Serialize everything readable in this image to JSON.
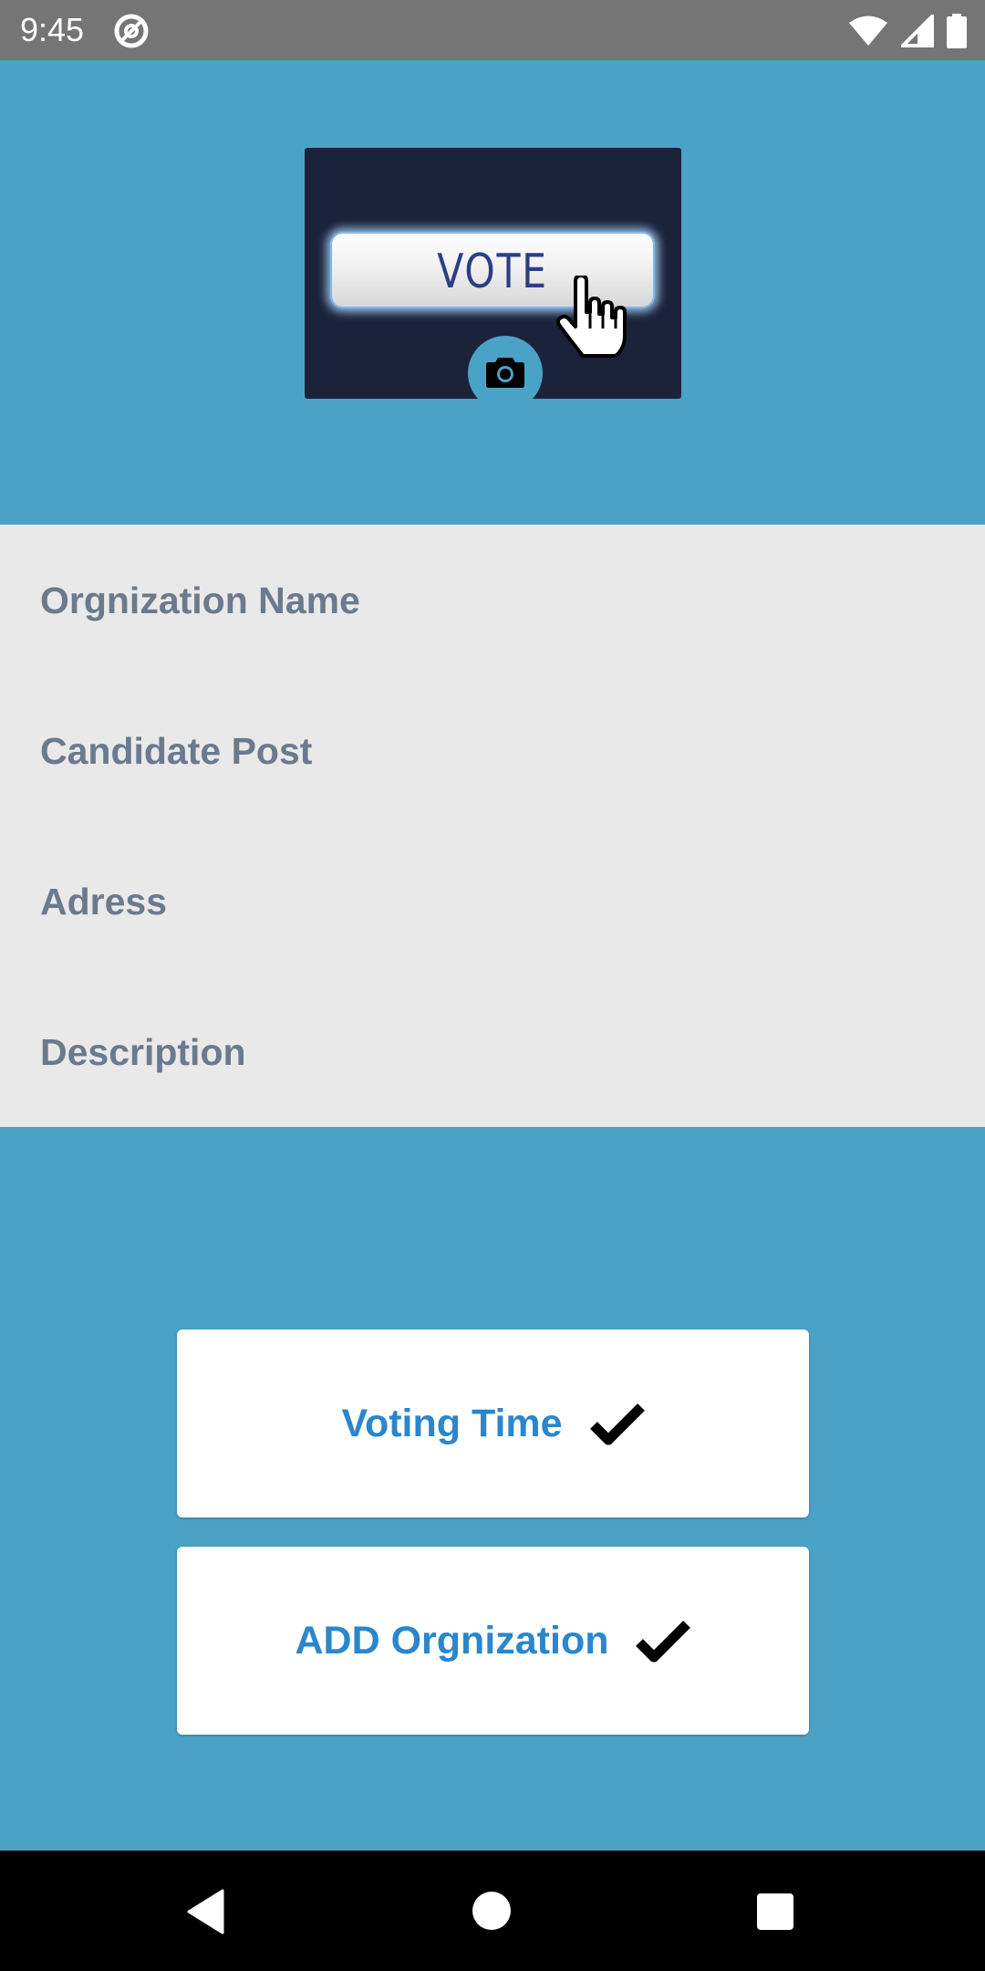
{
  "status_bar": {
    "time": "9:45",
    "icons": [
      "at-sign-icon",
      "wifi-icon",
      "signal-icon",
      "battery-icon"
    ]
  },
  "header": {
    "image_text": "VOTE",
    "background_color": "#4aa3c7",
    "image_background_color": "#1b233b"
  },
  "form": {
    "fields": [
      {
        "label": "Orgnization Name"
      },
      {
        "label": "Candidate Post"
      },
      {
        "label": "Adress"
      },
      {
        "label": "Description"
      }
    ]
  },
  "buttons": {
    "voting_time": {
      "label": "Voting Time",
      "icon": "check-icon"
    },
    "add_organization": {
      "label": "ADD Orgnization",
      "icon": "check-icon"
    }
  },
  "colors": {
    "accent_text": "#2a86cd",
    "label_text": "#6b7a8c",
    "form_background": "#e9e9ea"
  },
  "nav_bar": {
    "icons": [
      "back-icon",
      "home-icon",
      "recents-icon"
    ]
  }
}
